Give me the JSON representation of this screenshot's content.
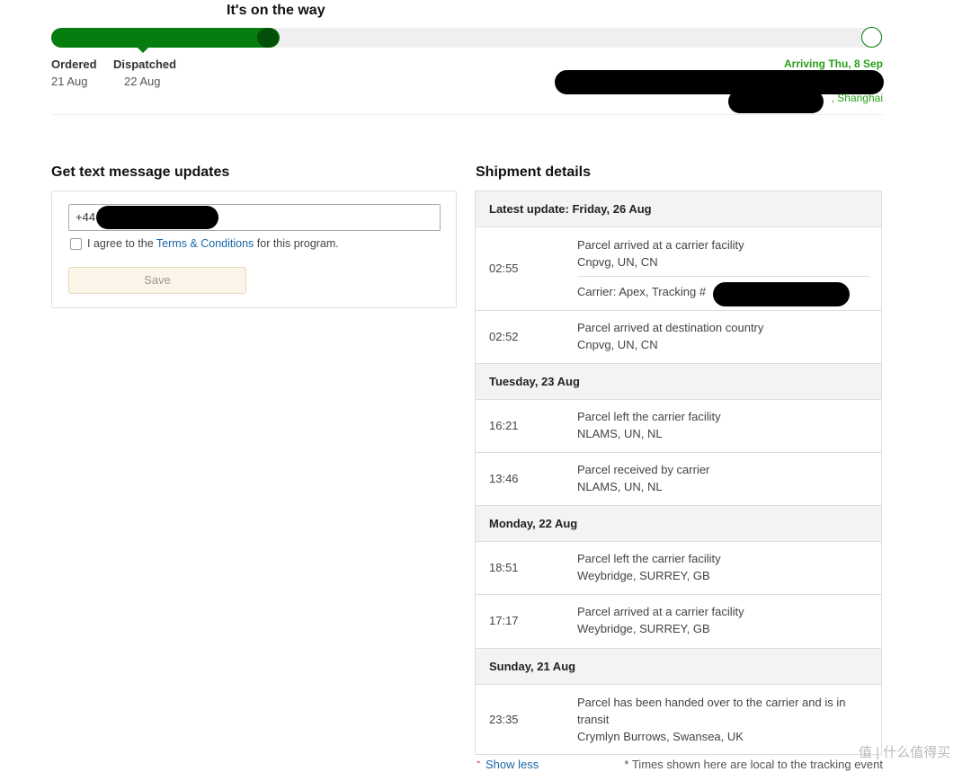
{
  "status": {
    "title": "It's on the way",
    "stages": [
      {
        "label": "Ordered",
        "date": "21 Aug"
      },
      {
        "label": "Dispatched",
        "date": "22 Aug"
      }
    ],
    "arriving": "Arriving Thu, 8 Sep",
    "destination_suffix": ", Shanghai",
    "accent_color": "#067d0e",
    "progress_percent": 27
  },
  "sms": {
    "title": "Get text message updates",
    "phone_prefix": "+44",
    "agree_prefix": "I agree to the ",
    "agree_link": "Terms & Conditions",
    "agree_suffix": " for this program.",
    "save_label": "Save"
  },
  "shipment": {
    "title": "Shipment details",
    "days": [
      {
        "heading": "Latest update: Friday, 26 Aug",
        "events": [
          {
            "time": "02:55",
            "desc": "Parcel arrived at a carrier facility",
            "location": "Cnpvg, UN, CN",
            "carrier": "Carrier: Apex, Tracking #"
          },
          {
            "time": "02:52",
            "desc": "Parcel arrived at destination country",
            "location": "Cnpvg, UN, CN"
          }
        ]
      },
      {
        "heading": "Tuesday, 23 Aug",
        "events": [
          {
            "time": "16:21",
            "desc": "Parcel left the carrier facility",
            "location": "NLAMS, UN, NL"
          },
          {
            "time": "13:46",
            "desc": "Parcel received by carrier",
            "location": "NLAMS, UN, NL"
          }
        ]
      },
      {
        "heading": "Monday, 22 Aug",
        "events": [
          {
            "time": "18:51",
            "desc": "Parcel left the carrier facility",
            "location": "Weybridge, SURREY, GB"
          },
          {
            "time": "17:17",
            "desc": "Parcel arrived at a carrier facility",
            "location": "Weybridge, SURREY, GB"
          }
        ]
      },
      {
        "heading": "Sunday, 21 Aug",
        "events": [
          {
            "time": "23:35",
            "desc": "Parcel has been handed over to the carrier and is in transit",
            "location": "Crymlyn Burrows, Swansea, UK"
          }
        ]
      }
    ],
    "show_less": "Show less",
    "show_less_icon": "double-chevron-up-icon",
    "note": "* Times shown here are local to the tracking event"
  },
  "watermark": "值 | 什么值得买"
}
